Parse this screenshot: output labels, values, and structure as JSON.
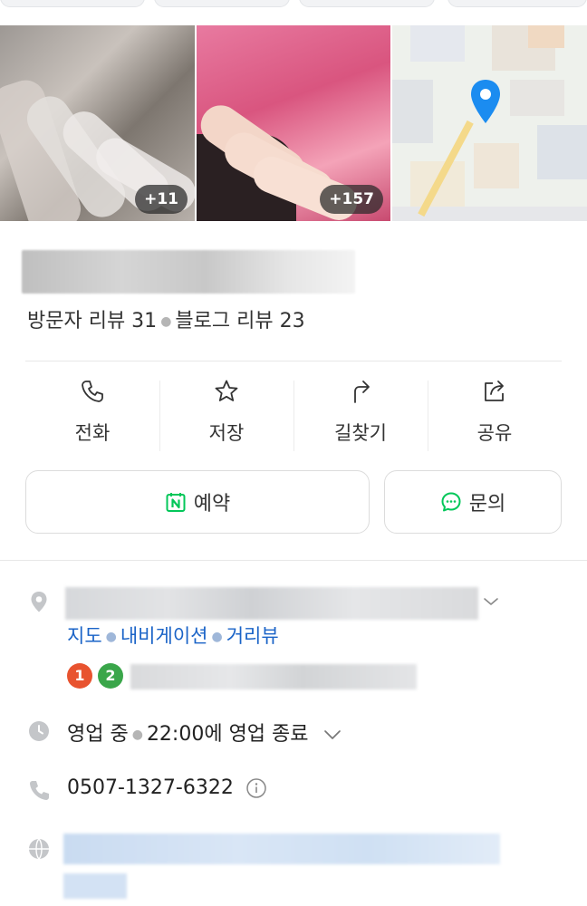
{
  "gallery": {
    "photo1_count": "+11",
    "photo2_count": "+157"
  },
  "place": {
    "reviews": {
      "visitor": "방문자 리뷰 31",
      "blog": "블로그 리뷰 23"
    }
  },
  "actions": [
    {
      "label": "전화",
      "icon": "phone-icon"
    },
    {
      "label": "저장",
      "icon": "star-icon"
    },
    {
      "label": "길찾기",
      "icon": "directions-icon"
    },
    {
      "label": "공유",
      "icon": "share-icon"
    }
  ],
  "buttons": {
    "reserve": "예약",
    "inquiry": "문의"
  },
  "info": {
    "links": [
      "지도",
      "내비게이션",
      "거리뷰"
    ],
    "subway_lines": [
      "1",
      "2"
    ],
    "hours_status": "영업 중",
    "hours_detail": "22:00에 영업 종료",
    "phone": "0507-1327-6322"
  },
  "colors": {
    "link": "#1a63c7",
    "naver_green": "#03c75a",
    "line1": "#e8532f",
    "line2": "#3aa64a",
    "map_pin": "#1b8cf0"
  }
}
